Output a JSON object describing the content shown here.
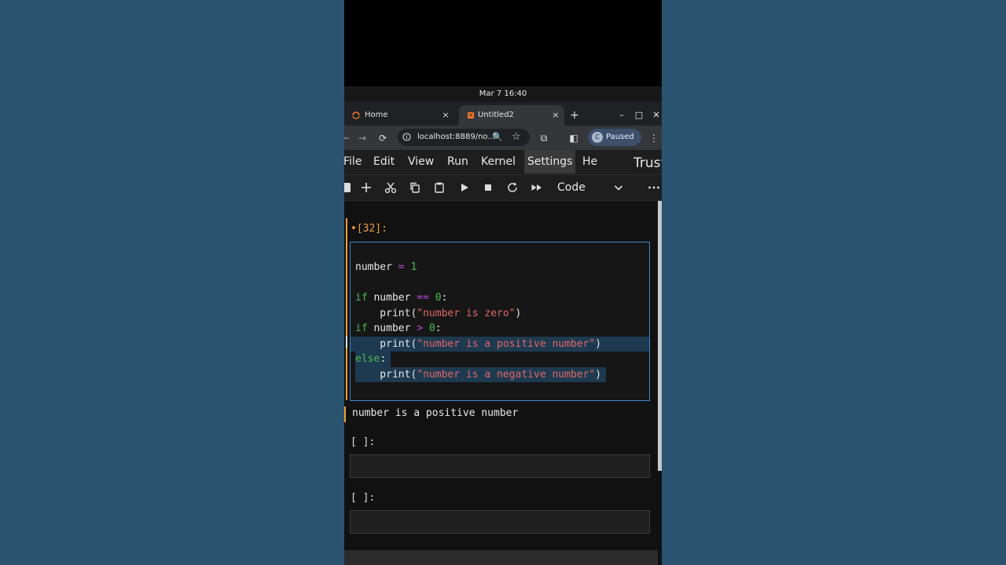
{
  "system": {
    "datetime": "Mar 7  16:40"
  },
  "browser": {
    "tabs": [
      {
        "label": "Home",
        "close": "×"
      },
      {
        "label": "Untitled2",
        "close": "×"
      }
    ],
    "newtab": "+",
    "window_controls": {
      "minimize": "–",
      "maximize": "□",
      "close": "✕"
    },
    "url": "localhost:8889/no...",
    "profile": {
      "initial": "C",
      "label": "Paused"
    }
  },
  "jupyter": {
    "menu": [
      "File",
      "Edit",
      "View",
      "Run",
      "Kernel",
      "Settings",
      "He"
    ],
    "active_menu": "Settings",
    "trusted": "Trusted",
    "toolbar_icons": [
      "save-icon",
      "add-icon",
      "cut-icon",
      "copy-icon",
      "paste-icon",
      "run-icon",
      "stop-icon",
      "restart-icon",
      "fast-forward-icon",
      "more-icon"
    ],
    "cell_type": "Code",
    "cells": [
      {
        "prompt": "•[32]:",
        "code": [
          "number = 1",
          "",
          "if number == 0:",
          "    print(\"number is zero\")",
          "if number > 0:",
          "    print(\"number is a positive number\")",
          "else:",
          "    print(\"number is a negative number\")"
        ],
        "output": "number is a positive number"
      },
      {
        "prompt": "[ ]:"
      },
      {
        "prompt": "[ ]:"
      }
    ]
  },
  "colors": {
    "background": "#2a536f",
    "accent_orange": "#f0a030",
    "editor_border": "#3d87c7",
    "keyword": "#49b84a",
    "operator": "#b34de0",
    "string": "#e06666"
  }
}
